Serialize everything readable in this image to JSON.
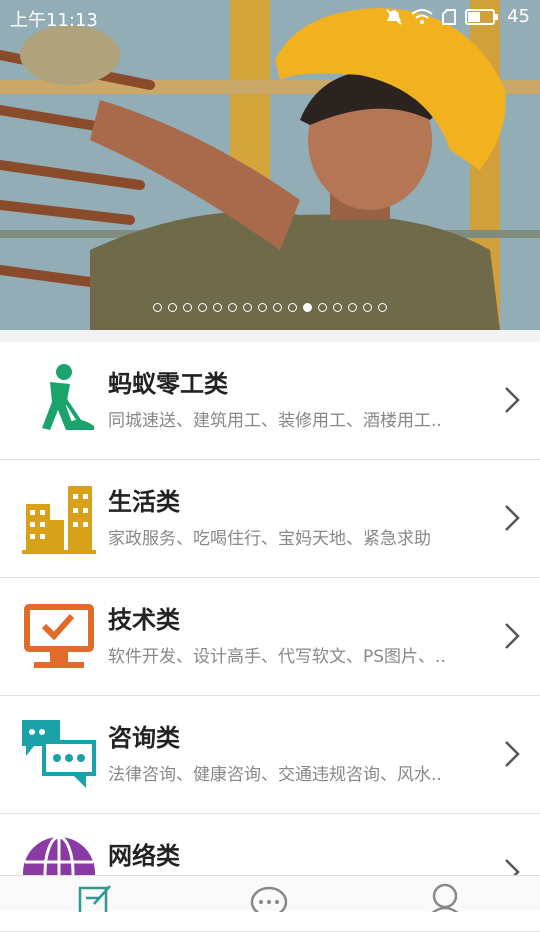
{
  "status_bar": {
    "time": "上午11:13",
    "battery": "45",
    "icons": [
      "mute-icon",
      "wifi-icon",
      "sim-icon",
      "battery-icon"
    ]
  },
  "banner": {
    "slide_count": 16,
    "active_index": 10
  },
  "categories": [
    {
      "title": "蚂蚁零工类",
      "subtitle": "同城速送、建筑用工、装修用工、酒楼用工..",
      "icon": "worker-shovel-icon",
      "color": "#1aa36a"
    },
    {
      "title": "生活类",
      "subtitle": "家政服务、吃喝住行、宝妈天地、紧急求助",
      "icon": "buildings-icon",
      "color": "#d7a21a"
    },
    {
      "title": "技术类",
      "subtitle": "软件开发、设计高手、代写软文、PS图片、..",
      "icon": "monitor-check-icon",
      "color": "#e36b2a"
    },
    {
      "title": "咨询类",
      "subtitle": "法律咨询、健康咨询、交通违规咨询、风水..",
      "icon": "chat-bubbles-icon",
      "color": "#1aa2a8"
    },
    {
      "title": "网络类",
      "subtitle": "",
      "icon": "globe-icon",
      "color": "#8a3aa3"
    }
  ],
  "tabbar": {
    "tabs": [
      {
        "icon": "edit-icon",
        "active": true,
        "color": "#2b9a8f"
      },
      {
        "icon": "chat-icon",
        "active": false,
        "color": "#888888"
      },
      {
        "icon": "user-icon",
        "active": false,
        "color": "#888888"
      }
    ]
  }
}
